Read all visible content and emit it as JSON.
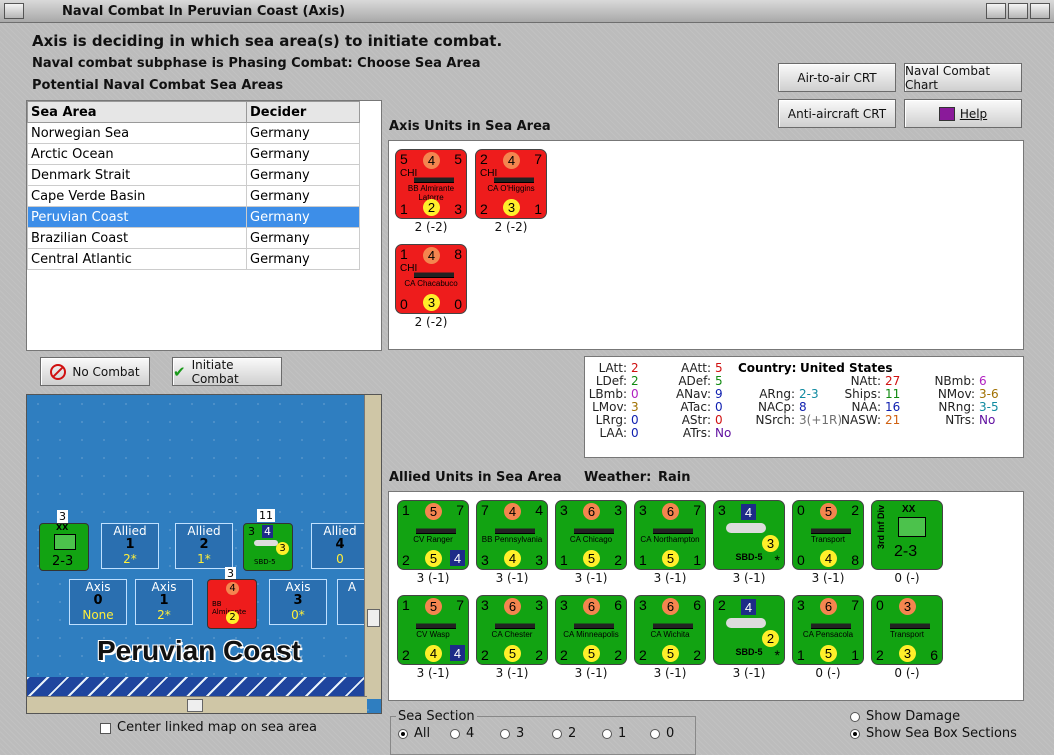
{
  "window": {
    "title": "Naval Combat In Peruvian Coast (Axis)"
  },
  "headings": {
    "line1": "Axis is deciding in which sea area(s) to initiate combat.",
    "line2": "Naval combat subphase is Phasing Combat: Choose Sea Area",
    "line3": "Potential Naval Combat Sea Areas"
  },
  "buttons": {
    "air_to_air": "Air-to-air CRT",
    "naval_chart": "Naval Combat Chart",
    "anti_aircraft": "Anti-aircraft CRT",
    "help": "Help",
    "no_combat": "No Combat",
    "initiate_combat": "Initiate Combat"
  },
  "sea_table": {
    "headers": [
      "Sea Area",
      "Decider"
    ],
    "rows": [
      {
        "area": "Norwegian Sea",
        "decider": "Germany"
      },
      {
        "area": "Arctic Ocean",
        "decider": "Germany"
      },
      {
        "area": "Denmark Strait",
        "decider": "Germany"
      },
      {
        "area": "Cape Verde Basin",
        "decider": "Germany"
      },
      {
        "area": "Peruvian Coast",
        "decider": "Germany"
      },
      {
        "area": "Brazilian Coast",
        "decider": "Germany"
      },
      {
        "area": "Central Atlantic",
        "decider": "Germany"
      }
    ]
  },
  "axis_units": {
    "title": "Axis Units in Sea Area",
    "units": [
      {
        "nation": "CHI",
        "name": "BB Almirante Latorre",
        "tl": "5",
        "tc": "4",
        "tr": "5",
        "bl": "1",
        "bc": "2",
        "br": "3",
        "label": "2 (-2)"
      },
      {
        "nation": "CHI",
        "name": "CA O'Higgins",
        "tl": "2",
        "tc": "4",
        "tr": "7",
        "bl": "2",
        "bc": "3",
        "br": "1",
        "label": "2 (-2)"
      },
      {
        "nation": "CHI",
        "name": "CA Chacabuco",
        "tl": "1",
        "tc": "4",
        "tr": "8",
        "bl": "0",
        "bc": "3",
        "br": "0",
        "label": "2 (-2)"
      }
    ]
  },
  "stats": {
    "country_label": "Country:",
    "country": "United States",
    "col1": [
      {
        "k": "LAtt:",
        "v": "2",
        "c": "#d01010"
      },
      {
        "k": "LDef:",
        "v": "2",
        "c": "#108a10"
      },
      {
        "k": "LBmb:",
        "v": "0",
        "c": "#b020c0"
      },
      {
        "k": "LMov:",
        "v": "3",
        "c": "#a07000"
      },
      {
        "k": "LRrg:",
        "v": "0",
        "c": "#1020b0"
      },
      {
        "k": "LAA:",
        "v": "0",
        "c": "#1020b0"
      }
    ],
    "col2": [
      {
        "k": "AAtt:",
        "v": "5",
        "c": "#d01010"
      },
      {
        "k": "ADef:",
        "v": "5",
        "c": "#108a10"
      },
      {
        "k": "ANav:",
        "v": "9",
        "c": "#1020b0"
      },
      {
        "k": "ATac:",
        "v": "0",
        "c": "#1020b0"
      },
      {
        "k": "AStr:",
        "v": "0",
        "c": "#d01010"
      },
      {
        "k": "ATrs:",
        "v": "No",
        "c": "#6010a0"
      }
    ],
    "col3": [
      {
        "k": "ARng:",
        "v": "2-3",
        "c": "#108aa0"
      },
      {
        "k": "NACp:",
        "v": "8",
        "c": "#1020b0"
      },
      {
        "k": "NSrch:",
        "v": "3(+1R)",
        "c": "#707070"
      }
    ],
    "col4": [
      {
        "k": "NAtt:",
        "v": "27",
        "c": "#d01010"
      },
      {
        "k": "Ships:",
        "v": "11",
        "c": "#108a10"
      },
      {
        "k": "NAA:",
        "v": "16",
        "c": "#1020b0"
      },
      {
        "k": "NASW:",
        "v": "21",
        "c": "#d06010"
      }
    ],
    "col5": [
      {
        "k": "NBmb:",
        "v": "6",
        "c": "#b020c0"
      },
      {
        "k": "NMov:",
        "v": "3-6",
        "c": "#a07000"
      },
      {
        "k": "NRng:",
        "v": "3-5",
        "c": "#108aa0"
      },
      {
        "k": "NTrs:",
        "v": "No",
        "c": "#6010a0"
      }
    ]
  },
  "allied": {
    "title": "Allied Units in Sea Area",
    "weather_label": "Weather:",
    "weather": "Rain",
    "row1": [
      {
        "name": "CV Ranger",
        "tl": "1",
        "tc": "5",
        "tr": "7",
        "bl": "2",
        "bc": "5",
        "br": "4",
        "bcType": "org",
        "label": "3 (-1)"
      },
      {
        "name": "BB Pennsylvania",
        "tl": "7",
        "tc": "4",
        "tr": "4",
        "bl": "3",
        "bc": "4",
        "br": "3",
        "label": "3 (-1)"
      },
      {
        "name": "CA Chicago",
        "tl": "3",
        "tc": "6",
        "tr": "3",
        "bl": "1",
        "bc": "5",
        "br": "2",
        "label": "3 (-1)"
      },
      {
        "name": "CA Northampton",
        "tl": "3",
        "tc": "6",
        "tr": "7",
        "bl": "1",
        "bc": "5",
        "br": "1",
        "label": "3 (-1)"
      },
      {
        "name": "SBD-5",
        "tl": "3",
        "tc": "4",
        "tr": "",
        "bl": "",
        "bc": "3",
        "br": "*",
        "label": "3 (-1)"
      },
      {
        "name": "Transport",
        "tl": "0",
        "tc": "5",
        "tr": "2",
        "bl": "0",
        "bc": "4",
        "br": "8",
        "label": "3 (-1)"
      },
      {
        "name": "3rd Inf Div",
        "tl": "",
        "tc": "XX",
        "tr": "",
        "bl": "",
        "bc": "2-3",
        "br": "",
        "label": "0 (-)"
      }
    ],
    "row2": [
      {
        "name": "CV Wasp",
        "tl": "1",
        "tc": "5",
        "tr": "7",
        "bl": "2",
        "bc": "4",
        "br": "4",
        "label": "3 (-1)"
      },
      {
        "name": "CA Chester",
        "tl": "3",
        "tc": "6",
        "tr": "3",
        "bl": "2",
        "bc": "5",
        "br": "2",
        "label": "3 (-1)"
      },
      {
        "name": "CA Minneapolis",
        "tl": "3",
        "tc": "6",
        "tr": "6",
        "bl": "2",
        "bc": "5",
        "br": "2",
        "label": "3 (-1)"
      },
      {
        "name": "CA Wichita",
        "tl": "3",
        "tc": "6",
        "tr": "6",
        "bl": "2",
        "bc": "5",
        "br": "2",
        "label": "3 (-1)"
      },
      {
        "name": "SBD-5",
        "tl": "2",
        "tc": "4",
        "tr": "",
        "bl": "",
        "bc": "2",
        "br": "*",
        "label": "3 (-1)"
      },
      {
        "name": "CA Pensacola",
        "tl": "3",
        "tc": "6",
        "tr": "7",
        "bl": "1",
        "bc": "5",
        "br": "1",
        "label": "0 (-)"
      },
      {
        "name": "Transport",
        "tl": "0",
        "tc": "3",
        "tr": "",
        "bl": "2",
        "bc": "3",
        "br": "6",
        "label": "0 (-)"
      }
    ]
  },
  "map": {
    "area_name": "Peruvian Coast",
    "allied_boxes": [
      {
        "name": "Allied",
        "num": "1",
        "val": "2*"
      },
      {
        "name": "Allied",
        "num": "2",
        "val": "1*"
      },
      {
        "name": "Allied",
        "num": "4",
        "val": "0"
      }
    ],
    "axis_boxes": [
      {
        "name": "Axis",
        "num": "0",
        "val": "None"
      },
      {
        "name": "Axis",
        "num": "1",
        "val": "2*"
      },
      {
        "name": "Axis",
        "num": "3",
        "val": "0*"
      },
      {
        "name": "A",
        "num": "",
        "val": ""
      }
    ],
    "counter_xx_nums": {
      "top": "3",
      "bottom": "2-3",
      "mid": "XX"
    },
    "counter_plane_nums": {
      "top": "11",
      "a": "3",
      "b": "4",
      "c": "3",
      "name": "SBD-5"
    },
    "counter_red_nums": {
      "top": "3",
      "a": "4",
      "b": "2",
      "name": "BB Almirante"
    }
  },
  "center_map": "Center linked map on sea area",
  "sea_section": {
    "title": "Sea Section",
    "options": [
      "All",
      "4",
      "3",
      "2",
      "1",
      "0"
    ],
    "selected": "All"
  },
  "show": {
    "damage": "Show Damage",
    "sections": "Show Sea Box Sections"
  },
  "colors": {
    "axis_red": "#ee1c1c",
    "allied_green": "#12a312",
    "selection_blue": "#3d8ee8",
    "sea_blue": "#2a6fb0"
  }
}
